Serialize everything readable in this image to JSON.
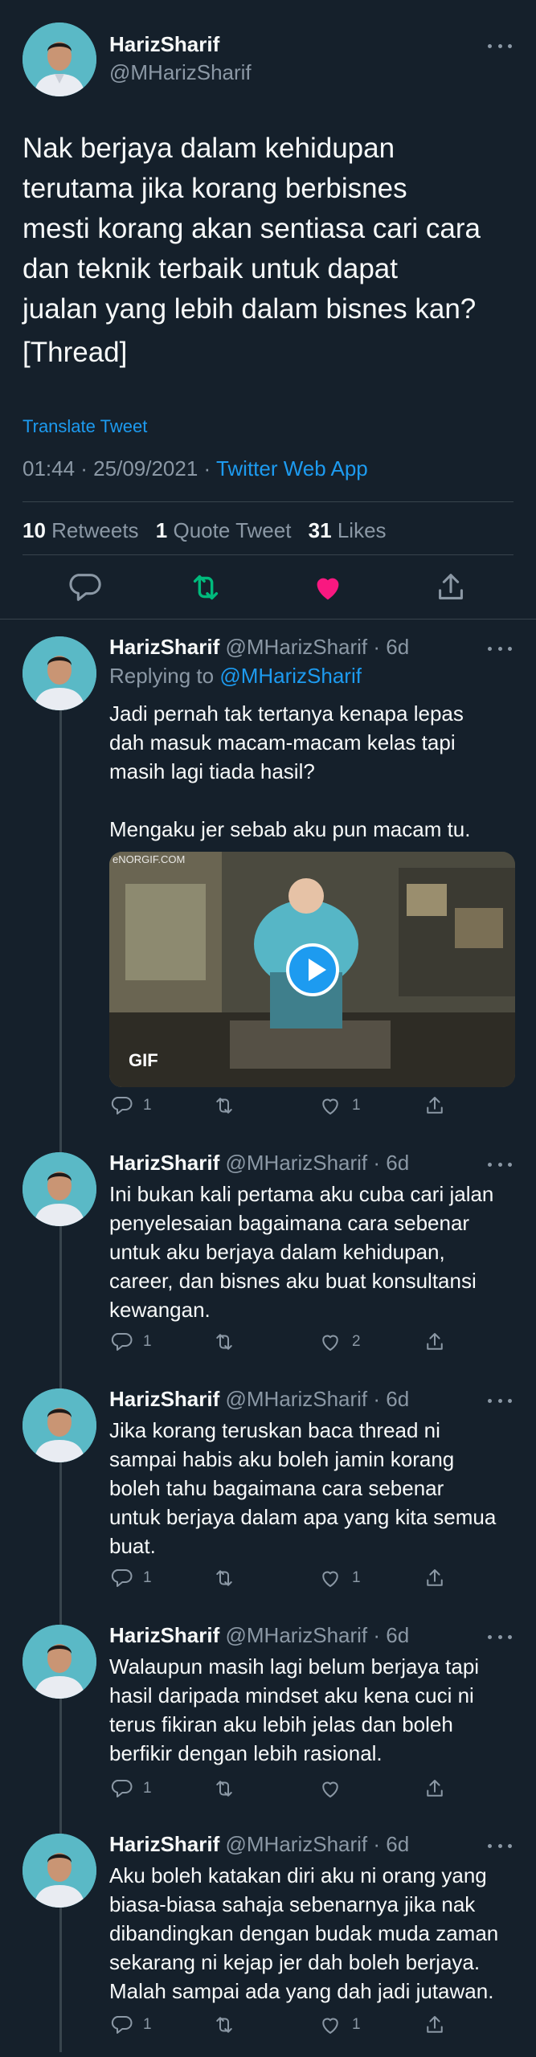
{
  "main_tweet": {
    "name": "HarizSharif",
    "handle": "@MHarizSharif",
    "text_lines": [
      "Nak berjaya dalam kehidupan",
      "terutama jika korang berbisnes",
      "mesti korang akan sentiasa cari cara",
      "dan teknik terbaik untuk dapat",
      "jualan yang lebih dalam bisnes kan?",
      "[Thread]"
    ],
    "translate_label": "Translate Tweet",
    "timestamp": "01:44 · 25/09/2021 · ",
    "app": "Twitter Web App",
    "retweets_count": "10",
    "retweets_label": "Retweets",
    "quote_count": "1",
    "quote_label": "Quote Tweet",
    "likes_count": "31",
    "likes_label": "Likes"
  },
  "colors": {
    "background": "#15202b",
    "accent": "#1d9bf0",
    "retweet_green": "#00ba7c",
    "like_pink": "#f91880",
    "muted": "#8b98a5"
  },
  "replies": [
    {
      "name": "HarizSharif",
      "handle": "@MHarizSharif · 6d",
      "replying_prefix": "Replying to ",
      "replying_to": "@MHarizSharif",
      "text_lines": [
        "Jadi pernah tak tertanya kenapa lepas",
        "dah masuk macam-macam kelas tapi",
        "masih lagi tiada hasil?",
        "",
        "Mengaku jer sebab aku pun macam tu."
      ],
      "gif_badge": "GIF",
      "gif_watermark": "eNORGIF.COM",
      "replies_count": "1",
      "retweets_count": "",
      "likes_count": "1"
    },
    {
      "name": "HarizSharif",
      "handle": "@MHarizSharif · 6d",
      "text_lines": [
        "Ini bukan kali pertama aku cuba cari jalan",
        "penyelesaian bagaimana cara sebenar",
        "untuk aku berjaya dalam kehidupan,",
        "career, dan bisnes aku buat konsultansi",
        "kewangan."
      ],
      "replies_count": "1",
      "retweets_count": "",
      "likes_count": "2"
    },
    {
      "name": "HarizSharif",
      "handle": "@MHarizSharif · 6d",
      "text_lines": [
        "Jika korang teruskan baca thread ni",
        "sampai habis aku boleh jamin korang",
        "boleh tahu bagaimana cara sebenar",
        "untuk berjaya dalam apa yang kita semua",
        "buat."
      ],
      "replies_count": "1",
      "retweets_count": "",
      "likes_count": "1"
    },
    {
      "name": "HarizSharif",
      "handle": "@MHarizSharif · 6d",
      "text_lines": [
        "Walaupun masih lagi belum berjaya tapi",
        "hasil daripada mindset aku kena cuci ni",
        "terus fikiran aku lebih jelas dan boleh",
        "berfikir dengan lebih rasional."
      ],
      "replies_count": "1",
      "retweets_count": "",
      "likes_count": ""
    },
    {
      "name": "HarizSharif",
      "handle": "@MHarizSharif · 6d",
      "text_lines": [
        "Aku boleh katakan diri aku ni orang yang",
        "biasa-biasa sahaja sebenarnya jika nak",
        "dibandingkan dengan budak muda zaman",
        "sekarang ni kejap jer dah boleh berjaya.",
        "Malah sampai ada yang dah jadi jutawan."
      ],
      "replies_count": "1",
      "retweets_count": "",
      "likes_count": "1"
    }
  ]
}
